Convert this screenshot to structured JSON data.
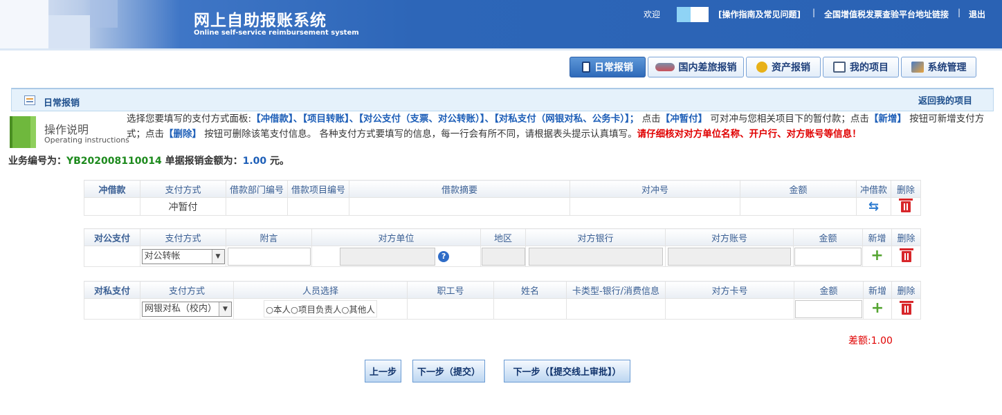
{
  "header": {
    "title": "网上自助报账系统",
    "subtitle": "Online self-service reimbursement system",
    "welcome": "欢迎",
    "links": [
      "[操作指南及常见问题]",
      "全国增值税发票查验平台地址链接",
      "退出"
    ],
    "separator": "|"
  },
  "nav": {
    "tabs": [
      "日常报销",
      "国内差旅报销",
      "资产报销",
      "我的项目",
      "系统管理"
    ]
  },
  "section": {
    "title": "日常报销",
    "back_link": "返回我的项目"
  },
  "instructions": {
    "title": "操作说明",
    "subtitle": "Operating instructions",
    "p1": "选择您要填写的支付方式面板:",
    "k1": "【冲借款】、【项目转账】、【对公支付（支票、对公转账）】、【对私支付（网银对私、公务卡）】；",
    "p2": " 点击",
    "k2": "【冲暂付】",
    "p3": " 可对冲与您相关项目下的暂付款；点击",
    "k3": "【新增】",
    "p4": " 按钮可新增支付方式；点击",
    "k4": "【删除】",
    "p5": " 按钮可删除该笔支付信息。 各种支付方式要填写的信息，每一行会有所不同，请根据表头提示认真填写。",
    "warn": "请仔细核对对方单位名称、开户行、对方账号等信息！"
  },
  "business": {
    "label": "业务编号为：",
    "number": "YB202008110014",
    "amount_label": " 单据报销金额为：",
    "amount": "1.00",
    "unit": " 元。"
  },
  "loan_table": {
    "label": "冲借款",
    "headers": [
      "支付方式",
      "借款部门编号",
      "借款项目编号",
      "借款摘要",
      "对冲号",
      "金额",
      "冲借款",
      "删除"
    ],
    "row_method": "冲暂付"
  },
  "public_table": {
    "label": "对公支付",
    "headers": [
      "支付方式",
      "附言",
      "对方单位",
      "地区",
      "对方银行",
      "对方账号",
      "金额",
      "新增",
      "删除"
    ],
    "method_value": "对公转帐"
  },
  "private_table": {
    "label": "对私支付",
    "headers": [
      "支付方式",
      "人员选择",
      "职工号",
      "姓名",
      "卡类型-银行/消费信息",
      "对方卡号",
      "金额",
      "新增",
      "删除"
    ],
    "method_value": "网银对私（校内）",
    "person_options": "○本人○项目负责人○其他人"
  },
  "difference": "差额:1.00",
  "buttons": [
    "上一步",
    "下一步（提交）",
    "下一步（【提交线上审批】）"
  ],
  "colors": {
    "header": "#2a62b4",
    "label_bg": "#2f78c9",
    "warn": "#e00000",
    "keyword": "#1e5fb8",
    "bizno": "#1d8a1d"
  }
}
